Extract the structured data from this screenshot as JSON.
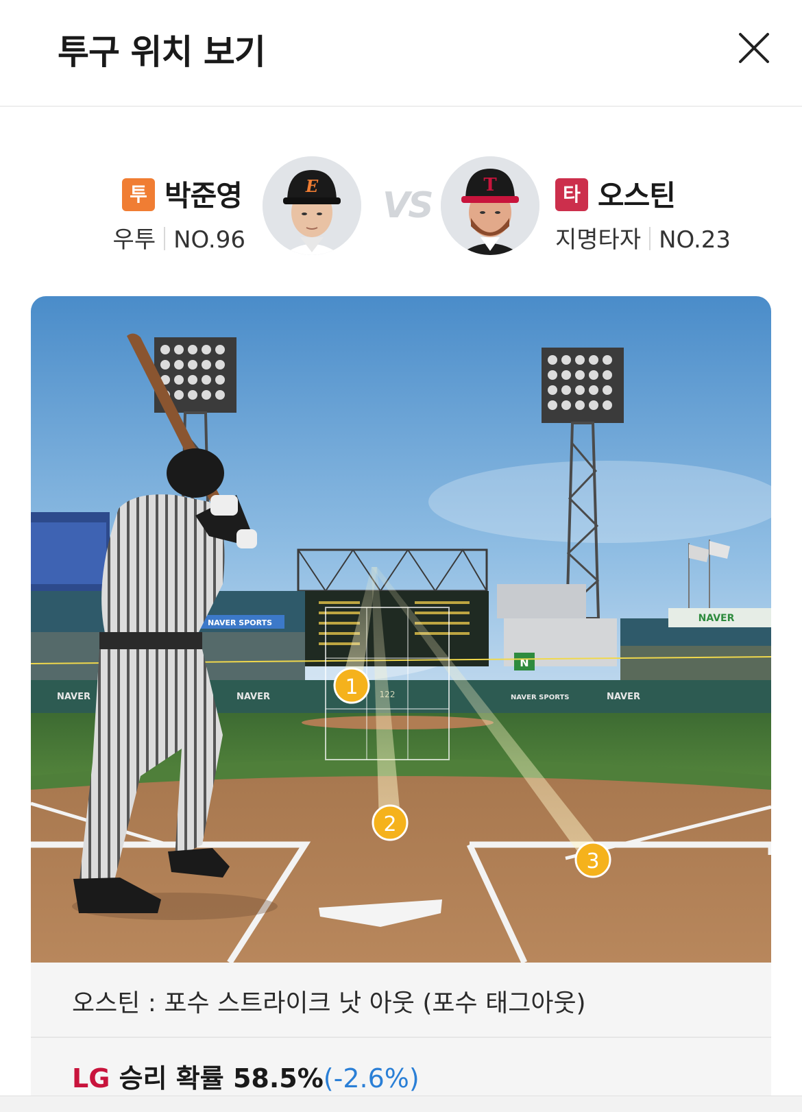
{
  "header": {
    "title": "투구 위치 보기"
  },
  "pitcher": {
    "badge": "투",
    "badge_color": "#f07d33",
    "name": "박준영",
    "throw": "우투",
    "number": "NO.96"
  },
  "batter": {
    "badge": "타",
    "badge_color": "#cc2f4c",
    "name": "오스틴",
    "position": "지명타자",
    "number": "NO.23"
  },
  "vs_label": "VS",
  "scene": {
    "ad_text": "NAVER",
    "ad_text_2": "NAVER SPORTS",
    "speed_label": "122",
    "pitches": [
      {
        "number": "1"
      },
      {
        "number": "2"
      },
      {
        "number": "3"
      }
    ]
  },
  "result": {
    "text": "오스틴 : 포수 스트라이크 낫 아웃 (포수 태그아웃)"
  },
  "win_probability": {
    "team": "LG",
    "label": " 승리 확률 ",
    "value": "58.5%",
    "change": "(-2.6%)"
  }
}
